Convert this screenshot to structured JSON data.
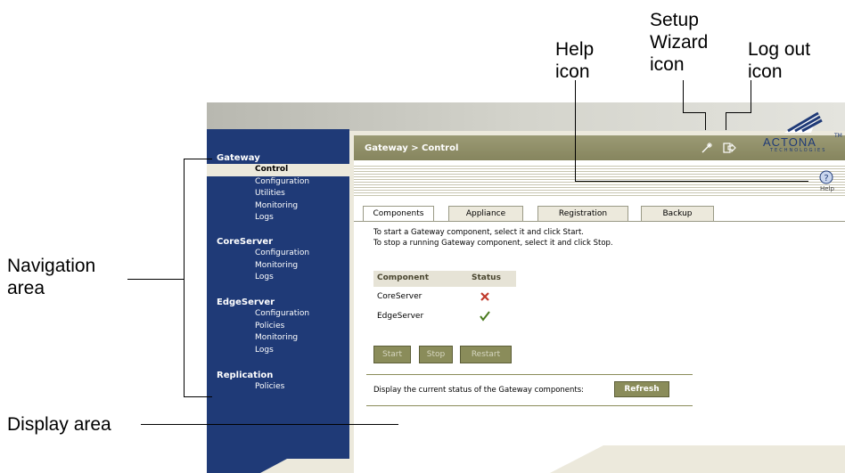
{
  "annotations": {
    "help_icon_label": [
      "Help",
      "icon"
    ],
    "setup_wizard_label": [
      "Setup",
      "Wizard",
      "icon"
    ],
    "logout_icon_label": [
      "Log out",
      "icon"
    ],
    "navigation_area_label": [
      "Navigation",
      "area"
    ],
    "display_area_label": "Display area"
  },
  "header": {
    "breadcrumb": "Gateway > Control",
    "help_label": "Help"
  },
  "logo": {
    "name": "ACTONA",
    "trademark": "TM",
    "subtitle": "TECHNOLOGIES"
  },
  "sidebar": {
    "groups": [
      {
        "title": "Gateway",
        "items": [
          "Control",
          "Configuration",
          "Utilities",
          "Monitoring",
          "Logs"
        ],
        "active": 0
      },
      {
        "title": "CoreServer",
        "items": [
          "Configuration",
          "Monitoring",
          "Logs"
        ]
      },
      {
        "title": "EdgeServer",
        "items": [
          "Configuration",
          "Policies",
          "Monitoring",
          "Logs"
        ]
      },
      {
        "title": "Replication",
        "items": [
          "Policies"
        ]
      }
    ]
  },
  "tabs": [
    "Components",
    "Appliance",
    "Registration",
    "Backup"
  ],
  "main": {
    "instructions": [
      "To start a Gateway component, select it and click Start.",
      "To stop a running Gateway component, select it and click Stop."
    ],
    "table": {
      "headers": [
        "Component",
        "Status"
      ],
      "rows": [
        {
          "component": "CoreServer",
          "status": "stopped"
        },
        {
          "component": "EdgeServer",
          "status": "running"
        }
      ]
    },
    "buttons": {
      "start": "Start",
      "stop": "Stop",
      "restart": "Restart"
    },
    "refresh_text": "Display the current status of the Gateway components:",
    "refresh_button": "Refresh"
  },
  "colors": {
    "sidebar": "#1f3a77",
    "header_bar": "#8f8e66",
    "button": "#8a8c5a",
    "stopped_status": "#c0392b",
    "running_status": "#4a7a1e"
  }
}
